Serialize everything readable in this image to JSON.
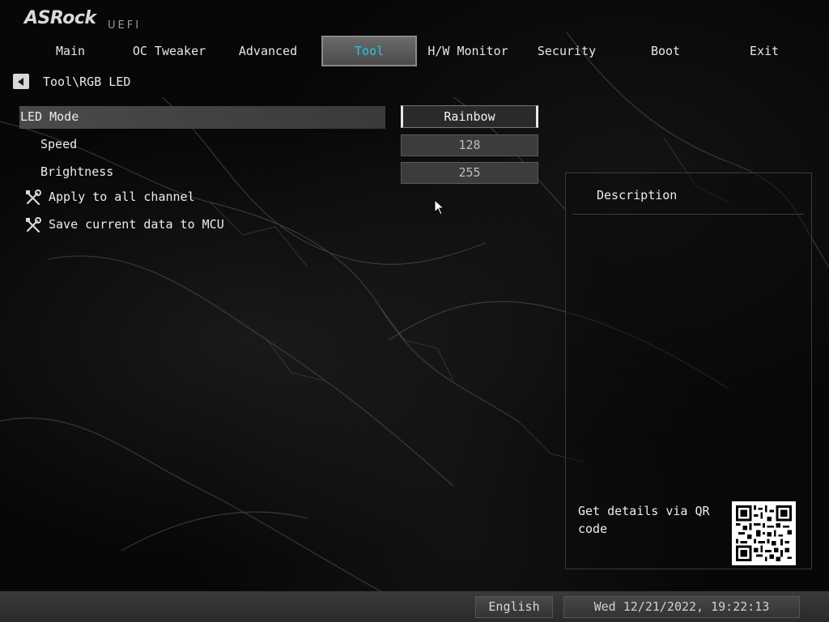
{
  "brand": {
    "logo": "ASRock",
    "sub": "UEFI"
  },
  "tabs": [
    {
      "label": "Main"
    },
    {
      "label": "OC Tweaker"
    },
    {
      "label": "Advanced"
    },
    {
      "label": "Tool",
      "active": true
    },
    {
      "label": "H/W Monitor"
    },
    {
      "label": "Security"
    },
    {
      "label": "Boot"
    },
    {
      "label": "Exit"
    }
  ],
  "breadcrumb": "Tool\\RGB LED",
  "settings": {
    "led_mode": {
      "label": "LED Mode",
      "value": "Rainbow"
    },
    "speed": {
      "label": "Speed",
      "value": "128"
    },
    "brightness": {
      "label": "Brightness",
      "value": "255"
    },
    "apply_all": {
      "label": "Apply to all channel",
      "icon": "tools-icon"
    },
    "save_mcu": {
      "label": "Save current data to MCU",
      "icon": "tools-icon"
    }
  },
  "description": {
    "title": "Description",
    "qr_text": "Get details via QR code"
  },
  "footer": {
    "language": "English",
    "datetime": "Wed 12/21/2022, 19:22:13"
  },
  "colors": {
    "active_tab_text": "#29c4e8",
    "background": "#050505"
  }
}
